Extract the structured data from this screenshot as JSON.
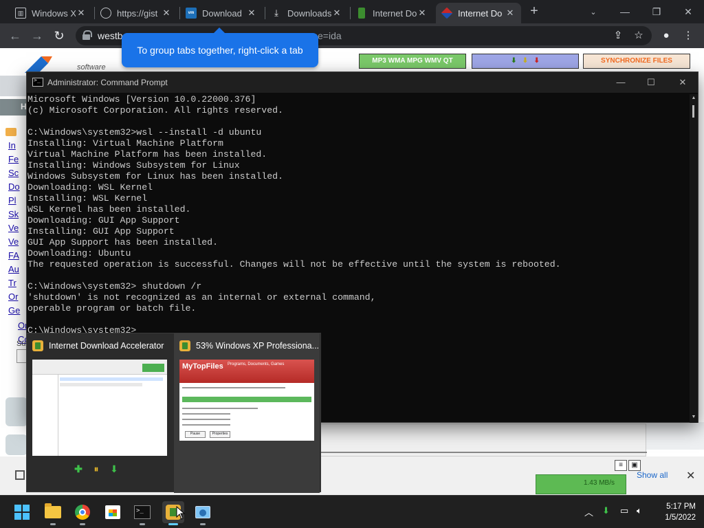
{
  "browser": {
    "tabs": [
      {
        "title": "Windows X",
        "favicon": "windows-icon",
        "active": false
      },
      {
        "title": "https://gist",
        "favicon": "globe-icon",
        "active": false
      },
      {
        "title": "Download",
        "favicon": "vmware-icon",
        "active": false
      },
      {
        "title": "Downloads",
        "favicon": "download-icon",
        "active": false
      },
      {
        "title": "Internet Do",
        "favicon": "ida-icon",
        "active": false
      },
      {
        "title": "Internet Do",
        "favicon": "ida-red-icon",
        "active": true
      }
    ],
    "new_tab": "+",
    "url_start": "westb",
    "url_end": "ce=ida",
    "tooltip": "To group tabs together, right-click a tab"
  },
  "webpage": {
    "tagline": "software",
    "nav_label": "H",
    "banners": [
      "MP3 WMA MPG WMV QT",
      "SYNCHRONIZE FILES"
    ],
    "left_links": [
      "In",
      "Fe",
      "Sc",
      "Do",
      "Pl",
      "Sk",
      "Ve",
      "Ve",
      "FA",
      "Au",
      "Tr",
      "Or",
      "Ge"
    ],
    "left_links2": [
      "Or",
      "Co"
    ],
    "side_label": "Su"
  },
  "cmd": {
    "title": "Administrator: Command Prompt",
    "lines": [
      "Microsoft Windows [Version 10.0.22000.376]",
      "(c) Microsoft Corporation. All rights reserved.",
      "",
      "C:\\Windows\\system32>wsl --install -d ubuntu",
      "Installing: Virtual Machine Platform",
      "Virtual Machine Platform has been installed.",
      "Installing: Windows Subsystem for Linux",
      "Windows Subsystem for Linux has been installed.",
      "Downloading: WSL Kernel",
      "Installing: WSL Kernel",
      "WSL Kernel has been installed.",
      "Downloading: GUI App Support",
      "Installing: GUI App Support",
      "GUI App Support has been installed.",
      "Downloading: Ubuntu",
      "The requested operation is successful. Changes will not be effective until the system is rebooted.",
      "",
      "C:\\Windows\\system32> shutdown /r",
      "'shutdown' is not recognized as an internal or external command,",
      "operable program or batch file.",
      "",
      "C:\\Windows\\system32>"
    ]
  },
  "flyout": {
    "cards": [
      {
        "title": "Internet Download Accelerator"
      },
      {
        "title": "53% Windows XP Professiona..."
      }
    ],
    "mytopfiles": {
      "brand": "MyTopFiles",
      "slogan": "Programs, Documents, Games",
      "buttons": [
        "Pause",
        "Properties"
      ]
    }
  },
  "ida_strip": {
    "show_all": "Show all",
    "speed": "1.43 MB/s"
  },
  "taskbar": {
    "apps": [
      "start-icon",
      "file-explorer-icon",
      "chrome-icon",
      "store-icon",
      "terminal-icon",
      "ida-icon",
      "remote-desktop-icon"
    ],
    "time": "5:17 PM",
    "date": "1/5/2022"
  }
}
